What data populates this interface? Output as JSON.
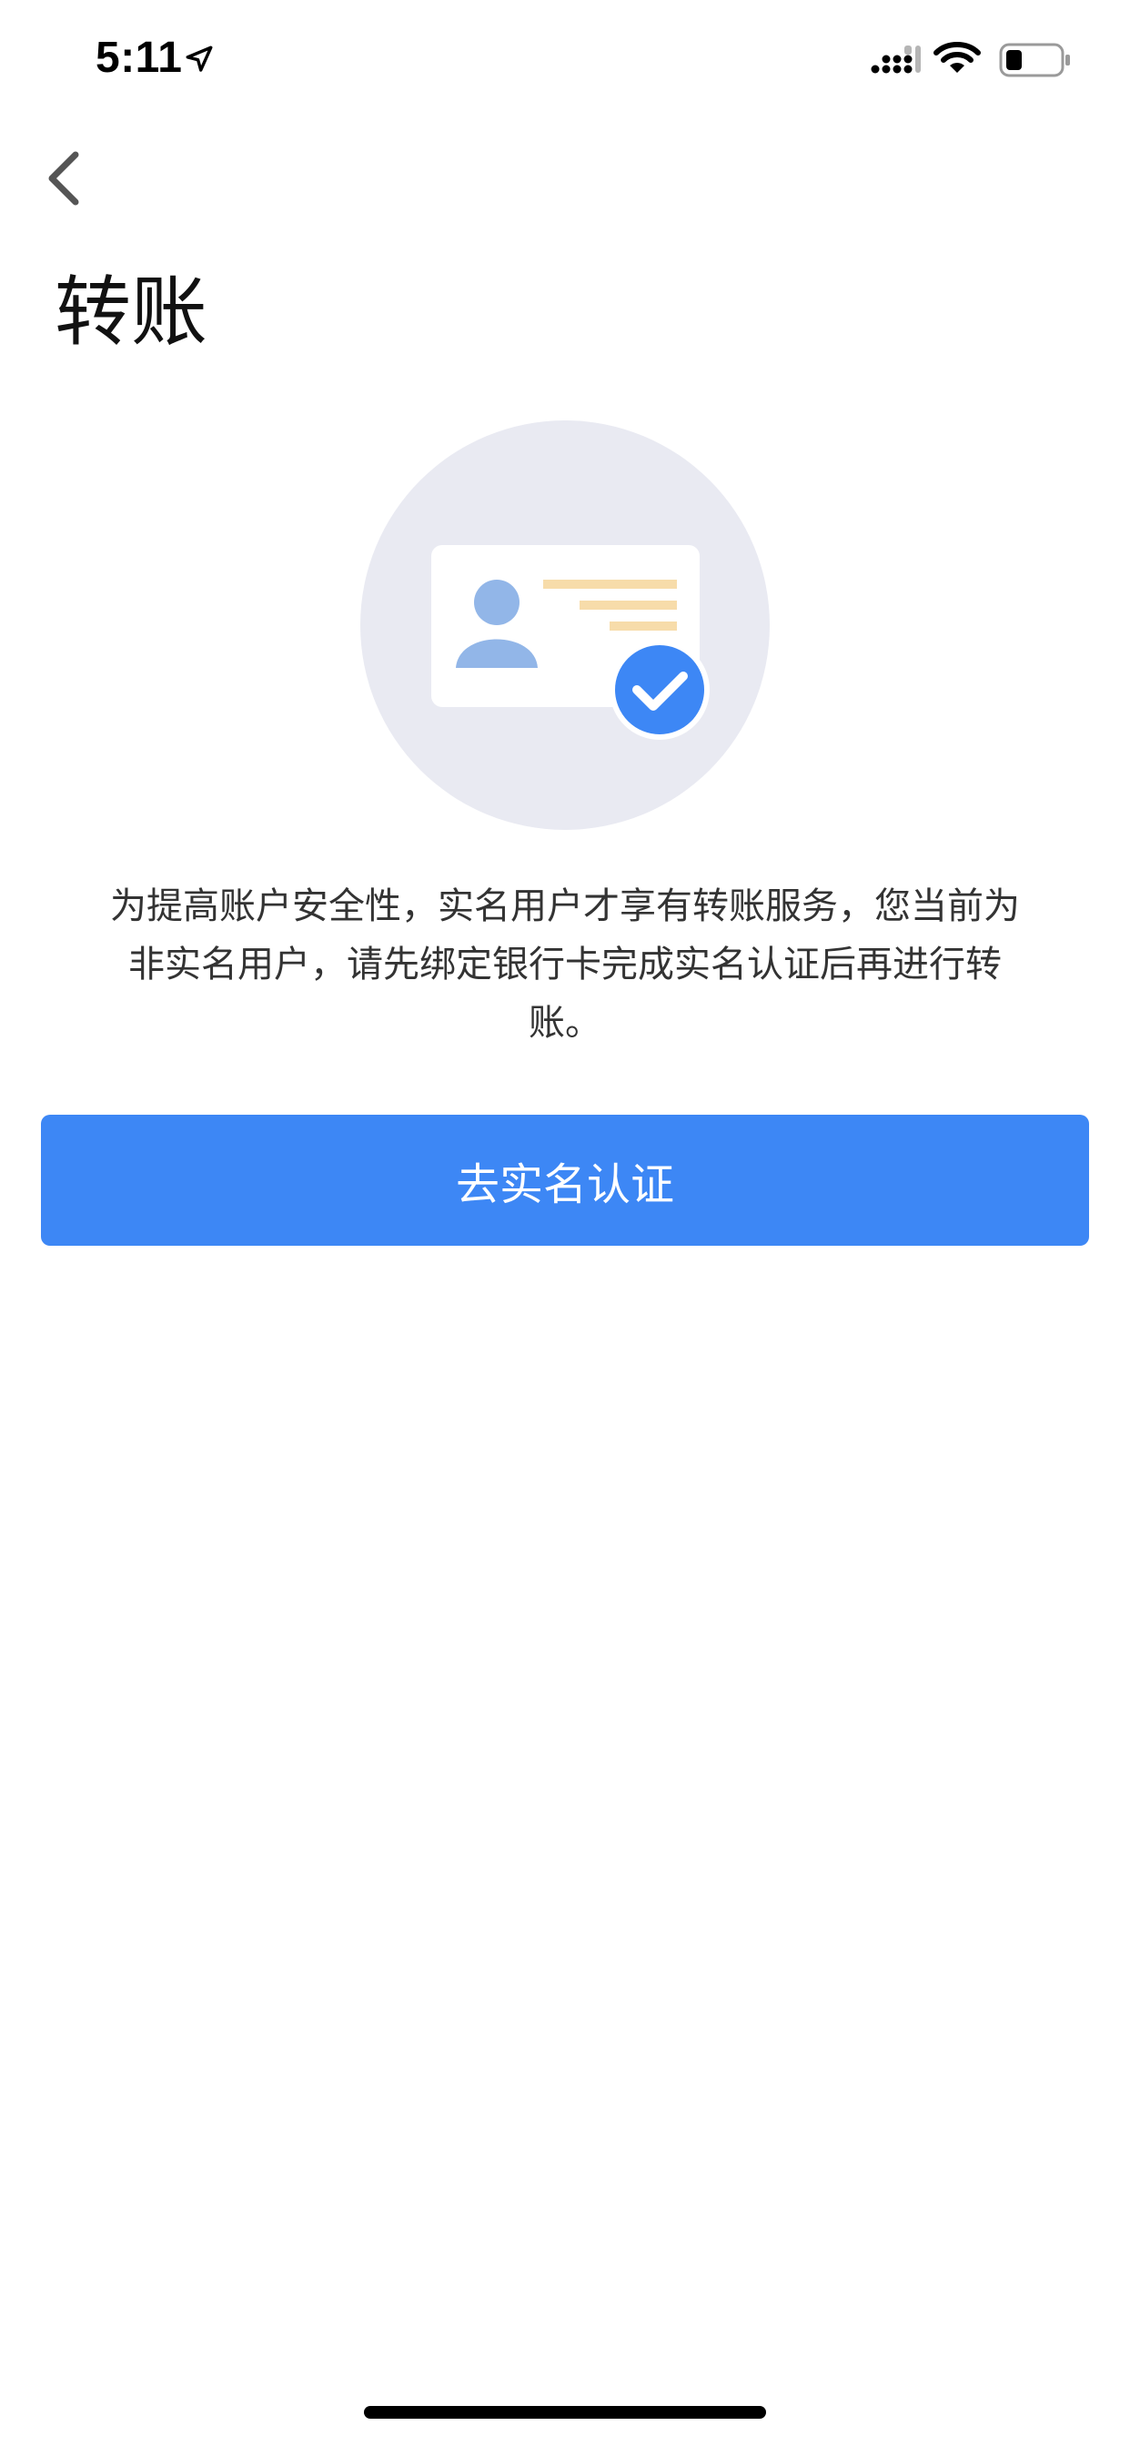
{
  "status_bar": {
    "time": "5:11",
    "icons": [
      "location-arrow-icon",
      "cellular-signal-icon",
      "wifi-icon",
      "battery-icon"
    ]
  },
  "nav": {
    "back_icon": "chevron-left-icon"
  },
  "page": {
    "title": "转账",
    "message": "为提高账户安全性，实名用户才享有转账服务，您当前为非实名用户，请先绑定银行卡完成实名认证后再进行转账。",
    "button_label": "去实名认证"
  },
  "illustration": {
    "icon": "id-card-verified-icon"
  },
  "colors": {
    "accent": "#3d87f5",
    "circle_bg": "#e9eaf2",
    "avatar": "#92b6e8",
    "card_lines": "#f7dcaa",
    "text": "#333333"
  }
}
